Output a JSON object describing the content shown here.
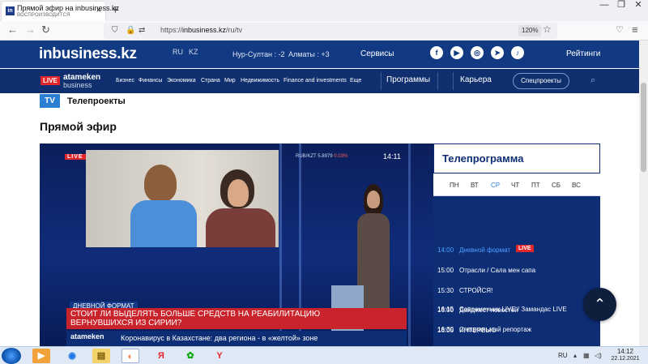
{
  "browser": {
    "tab": {
      "title": "Прямой эфир на inbusiness.kz",
      "subtitle": "ВОСПРОИЗВОДИТСЯ",
      "favicon": "in"
    },
    "new_tab": "+",
    "window_controls": [
      "—",
      "❐",
      "✕"
    ],
    "url": {
      "scheme": "https://",
      "host": "inbusiness.kz",
      "path": "/ru/tv"
    },
    "zoom": "120%"
  },
  "site": {
    "logo": "inbusiness.kz",
    "languages": [
      "RU",
      "KZ"
    ],
    "weather": [
      {
        "city": "Нур-Султан :",
        "temp": "-2"
      },
      {
        "city": "Алматы :",
        "temp": "+3"
      }
    ],
    "services": "Сервисы",
    "social_icons": [
      "facebook-icon",
      "youtube-icon",
      "instagram-icon",
      "telegram-icon",
      "tiktok-icon"
    ],
    "ratings": "Рейтинги",
    "brand": {
      "live": "LIVE",
      "name": "atameken",
      "sub": "business"
    },
    "menu": [
      "Бизнес",
      "Финансы",
      "Экономика",
      "Страна",
      "Мир",
      "Недвижимость",
      "Finance and investments",
      "Еще"
    ],
    "programs": "Программы",
    "career": "Карьера",
    "special": "Спецпроекты"
  },
  "section": {
    "badge": "TV",
    "title": "Телепроекты"
  },
  "page_title": "Прямой эфир",
  "video": {
    "live": "LIVE",
    "ticker": {
      "pair": "RUB/KZT",
      "value": "5.8979",
      "change": "0.03%"
    },
    "clock": "14:11",
    "show": "ДНЕВНОЙ ФОРМАТ",
    "headline_1": "СТОИТ ЛИ ВЫДЕЛЯТЬ БОЛЬШЕ СРЕДСТВ НА РЕАБИЛИТАЦИЮ",
    "headline_2": "ВЕРНУВШИХСЯ ИЗ СИРИИ?",
    "bottom_brand": "atameken",
    "bottom_news": "Коронавирус в Казахстане: два региона - в «желтой» зоне"
  },
  "tv_program": {
    "title": "Телепрограмма",
    "days": [
      "ПН",
      "ВТ",
      "СР",
      "ЧТ",
      "ПТ",
      "СБ",
      "ВС"
    ],
    "active_day": "СР",
    "items": [
      {
        "time": "14:00",
        "name": "Дневной формат",
        "live": "LIVE"
      },
      {
        "time": "15:00",
        "name": "Отрасли / Сала мен сапа"
      },
      {
        "time": "15:30",
        "name": "СТРОЙСЯ!"
      },
      {
        "time": "16:00",
        "name": "Дайджест новостей"
      },
      {
        "time": "16:05",
        "name": "ИНТЕРВЬЮ"
      },
      {
        "time": "16:15",
        "name": "Современник LIVE / Замандас LIVE"
      },
      {
        "time": "16:30",
        "name": "Специальный репортаж"
      }
    ]
  },
  "taskbar": {
    "apps": [
      "media-player-icon",
      "chrome-icon",
      "file-explorer-icon",
      "firefox-icon",
      "yandex-icon",
      "game-icon",
      "yandex-browser-icon"
    ],
    "lang": "RU",
    "time": "14:12",
    "date": "22.12.2021"
  },
  "colors": {
    "brand_blue": "#123a82",
    "nav_blue": "#0f2f6e",
    "live_red": "#e3252c",
    "accent": "#2a7fd2"
  }
}
